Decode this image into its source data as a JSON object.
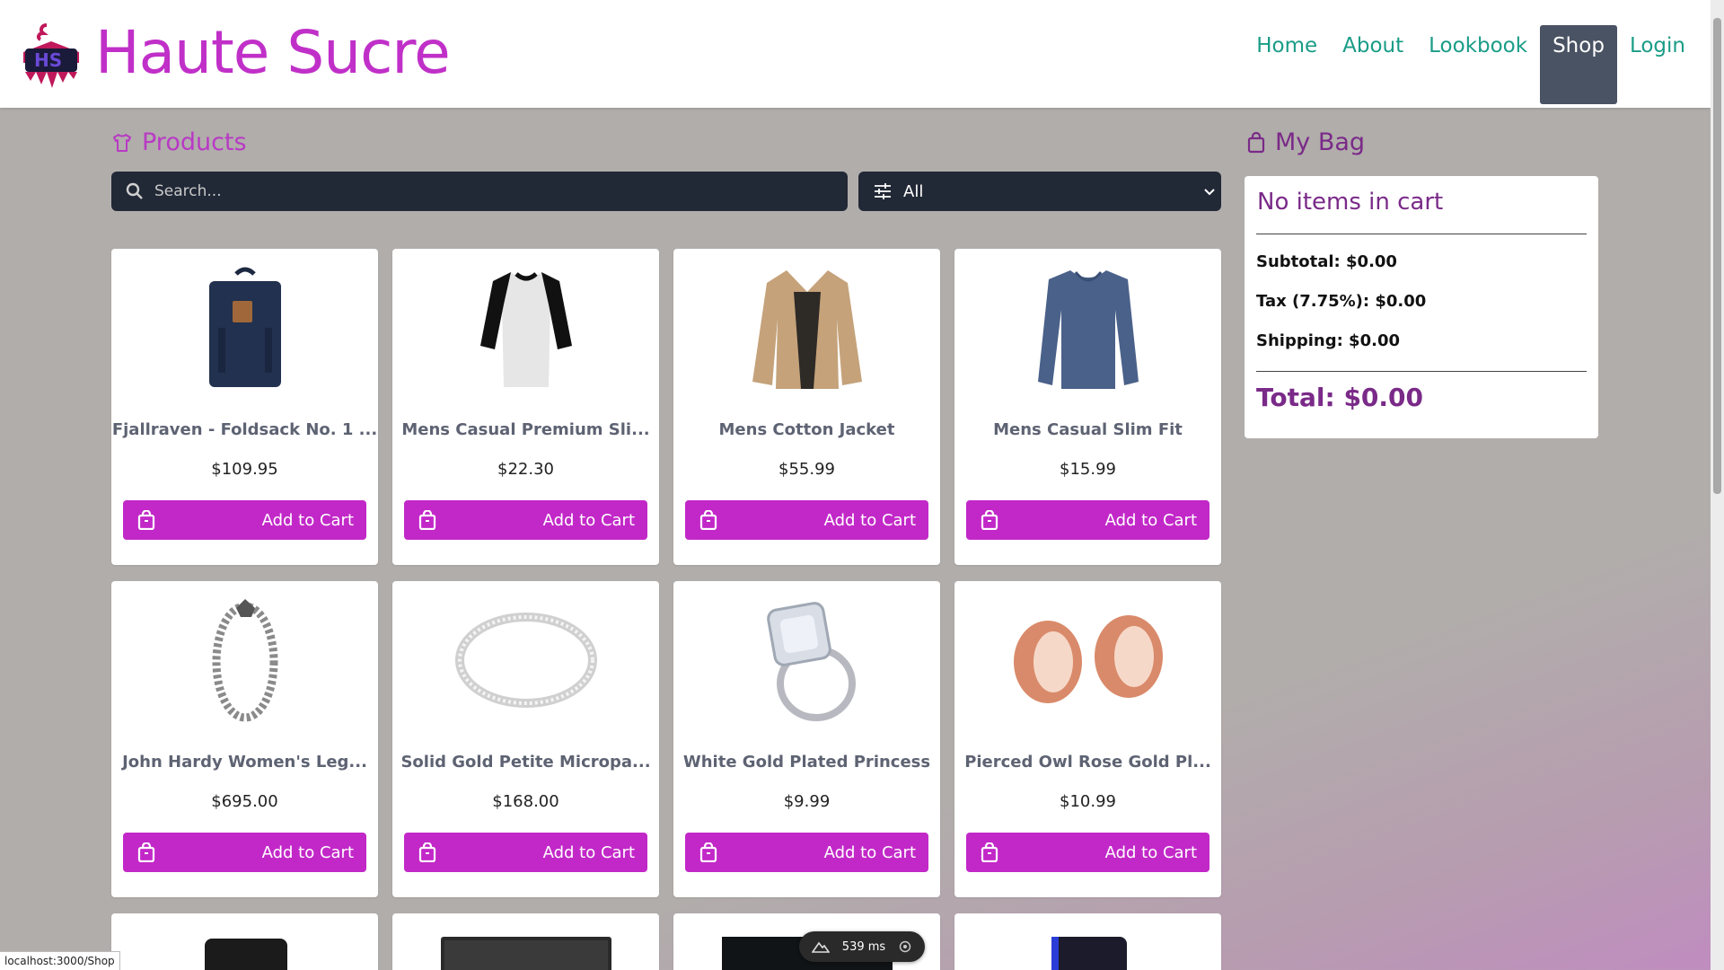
{
  "header": {
    "brand": "Haute Sucre",
    "nav": [
      "Home",
      "About",
      "Lookbook",
      "Shop",
      "Login"
    ],
    "active": "Shop"
  },
  "products": {
    "title": "Products",
    "search_placeholder": "Search...",
    "filter_value": "All",
    "add_to_cart": "Add to Cart",
    "items": [
      {
        "name": "Fjallraven - Foldsack No. 1 ...",
        "price": "$109.95",
        "icon": "backpack"
      },
      {
        "name": "Mens Casual Premium Sli...",
        "price": "$22.30",
        "icon": "raglan-tshirt"
      },
      {
        "name": "Mens Cotton Jacket",
        "price": "$55.99",
        "icon": "jacket"
      },
      {
        "name": "Mens Casual Slim Fit",
        "price": "$15.99",
        "icon": "long-sleeve-shirt"
      },
      {
        "name": "John Hardy Women's Leg...",
        "price": "$695.00",
        "icon": "chain-bracelet"
      },
      {
        "name": "Solid Gold Petite Micropa...",
        "price": "$168.00",
        "icon": "band-ring"
      },
      {
        "name": "White Gold Plated Princess",
        "price": "$9.99",
        "icon": "diamond-ring"
      },
      {
        "name": "Pierced Owl Rose Gold Pl...",
        "price": "$10.99",
        "icon": "rose-gold-plugs"
      }
    ]
  },
  "bag": {
    "title": "My Bag",
    "empty_text": "No items in cart",
    "subtotal": "Subtotal: $0.00",
    "tax": "Tax (7.75%): $0.00",
    "shipping": "Shipping: $0.00",
    "total": "Total: $0.00"
  },
  "status_url": "localhost:3000/Shop",
  "timer": "539 ms",
  "colors": {
    "brand": "#c030c8",
    "nav": "#1a9c87",
    "button": "#c228c8",
    "dark": "#212836"
  }
}
